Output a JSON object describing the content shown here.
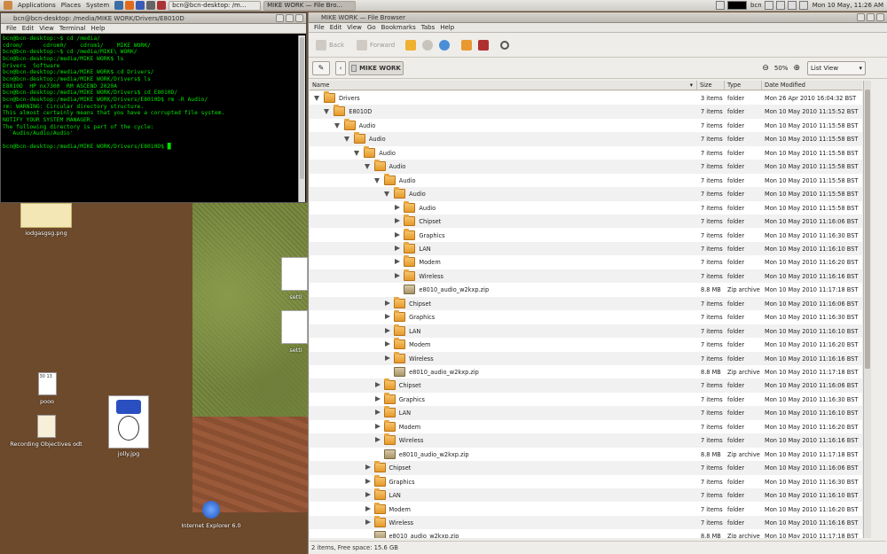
{
  "panel": {
    "applications": "Applications",
    "places": "Places",
    "system": "System",
    "task_terminal": "bcn@bcn-desktop: /m...",
    "task_filebrowser": "MIKE WORK — File Bro...",
    "user": "bcn",
    "clock": "Mon 10 May, 11:26 AM"
  },
  "desktop": {
    "icons": [
      {
        "label": "iodgasgsg.png"
      },
      {
        "label": "pooo"
      },
      {
        "label": "Recording Objectives odt"
      },
      {
        "label": "jolly.jpg"
      },
      {
        "label": "Internet Explorer 6.0"
      }
    ],
    "partial_labels": [
      "setti",
      "setti"
    ],
    "pooo_thumb_text": "30 13"
  },
  "terminal": {
    "title": "bcn@bcn-desktop: /media/MIKE WORK/Drivers/E8010D",
    "menu": [
      "File",
      "Edit",
      "View",
      "Terminal",
      "Help"
    ],
    "lines": [
      "bcn@bcn-desktop:~$ cd /media/",
      "cdrom/      cdrom0/    cdrom1/    MIKE WORK/",
      "bcn@bcn-desktop:~$ cd /media/MIKE\\ WORK/",
      "bcn@bcn-desktop:/media/MIKE WORK$ ls",
      "Drivers  Software",
      "bcn@bcn-desktop:/media/MIKE WORK$ cd Drivers/",
      "bcn@bcn-desktop:/media/MIKE WORK/Drivers$ ls",
      "E8010D  HP nx7300  RM ASCEND 2020A",
      "bcn@bcn-desktop:/media/MIKE WORK/Drivers$ cd E8010D/",
      "bcn@bcn-desktop:/media/MIKE WORK/Drivers/E8010D$ rm -R Audio/",
      "rm: WARNING: Circular directory structure.",
      "This almost certainly means that you have a corrupted file system.",
      "NOTIFY YOUR SYSTEM MANAGER.",
      "The following directory is part of the cycle:",
      "  `Audio/Audio/Audio'",
      "",
      "bcn@bcn-desktop:/media/MIKE WORK/Drivers/E8010D$ █"
    ]
  },
  "filebrowser": {
    "title": "MIKE WORK — File Browser",
    "menu": [
      "File",
      "Edit",
      "View",
      "Go",
      "Bookmarks",
      "Tabs",
      "Help"
    ],
    "toolbar": {
      "back": "Back",
      "forward": "Forward"
    },
    "location": "MIKE WORK",
    "zoom": "50%",
    "view_mode": "List View",
    "columns": [
      "Name",
      "Size",
      "Type",
      "Date Modified"
    ],
    "rows": [
      {
        "depth": 0,
        "exp": "open",
        "icon": "folder",
        "name": "Drivers",
        "size": "3 items",
        "type": "folder",
        "date": "Mon 26 Apr 2010 16:04:32 BST"
      },
      {
        "depth": 1,
        "exp": "open",
        "icon": "folder",
        "name": "E8010D",
        "size": "7 items",
        "type": "folder",
        "date": "Mon 10 May 2010 11:15:52 BST"
      },
      {
        "depth": 2,
        "exp": "open",
        "icon": "folder",
        "name": "Audio",
        "size": "7 items",
        "type": "folder",
        "date": "Mon 10 May 2010 11:15:58 BST"
      },
      {
        "depth": 3,
        "exp": "open",
        "icon": "folder",
        "name": "Audio",
        "size": "7 items",
        "type": "folder",
        "date": "Mon 10 May 2010 11:15:58 BST"
      },
      {
        "depth": 4,
        "exp": "open",
        "icon": "folder",
        "name": "Audio",
        "size": "7 items",
        "type": "folder",
        "date": "Mon 10 May 2010 11:15:58 BST"
      },
      {
        "depth": 5,
        "exp": "open",
        "icon": "folder",
        "name": "Audio",
        "size": "7 items",
        "type": "folder",
        "date": "Mon 10 May 2010 11:15:58 BST"
      },
      {
        "depth": 6,
        "exp": "open",
        "icon": "folder",
        "name": "Audio",
        "size": "7 items",
        "type": "folder",
        "date": "Mon 10 May 2010 11:15:58 BST"
      },
      {
        "depth": 7,
        "exp": "open",
        "icon": "folder",
        "name": "Audio",
        "size": "7 items",
        "type": "folder",
        "date": "Mon 10 May 2010 11:15:58 BST"
      },
      {
        "depth": 8,
        "exp": "closed",
        "icon": "folder",
        "name": "Audio",
        "size": "7 items",
        "type": "folder",
        "date": "Mon 10 May 2010 11:15:58 BST"
      },
      {
        "depth": 8,
        "exp": "closed",
        "icon": "folder",
        "name": "Chipset",
        "size": "7 items",
        "type": "folder",
        "date": "Mon 10 May 2010 11:16:06 BST"
      },
      {
        "depth": 8,
        "exp": "closed",
        "icon": "folder",
        "name": "Graphics",
        "size": "7 items",
        "type": "folder",
        "date": "Mon 10 May 2010 11:16:30 BST"
      },
      {
        "depth": 8,
        "exp": "closed",
        "icon": "folder",
        "name": "LAN",
        "size": "7 items",
        "type": "folder",
        "date": "Mon 10 May 2010 11:16:10 BST"
      },
      {
        "depth": 8,
        "exp": "closed",
        "icon": "folder",
        "name": "Modem",
        "size": "7 items",
        "type": "folder",
        "date": "Mon 10 May 2010 11:16:20 BST"
      },
      {
        "depth": 8,
        "exp": "closed",
        "icon": "folder",
        "name": "Wireless",
        "size": "7 items",
        "type": "folder",
        "date": "Mon 10 May 2010 11:16:16 BST"
      },
      {
        "depth": 8,
        "exp": "none",
        "icon": "zip",
        "name": "e8010_audio_w2kxp.zip",
        "size": "8.8 MB",
        "type": "Zip archive",
        "date": "Mon 10 May 2010 11:17:18 BST"
      },
      {
        "depth": 7,
        "exp": "closed",
        "icon": "folder",
        "name": "Chipset",
        "size": "7 items",
        "type": "folder",
        "date": "Mon 10 May 2010 11:16:06 BST"
      },
      {
        "depth": 7,
        "exp": "closed",
        "icon": "folder",
        "name": "Graphics",
        "size": "7 items",
        "type": "folder",
        "date": "Mon 10 May 2010 11:16:30 BST"
      },
      {
        "depth": 7,
        "exp": "closed",
        "icon": "folder",
        "name": "LAN",
        "size": "7 items",
        "type": "folder",
        "date": "Mon 10 May 2010 11:16:10 BST"
      },
      {
        "depth": 7,
        "exp": "closed",
        "icon": "folder",
        "name": "Modem",
        "size": "7 items",
        "type": "folder",
        "date": "Mon 10 May 2010 11:16:20 BST"
      },
      {
        "depth": 7,
        "exp": "closed",
        "icon": "folder",
        "name": "Wireless",
        "size": "7 items",
        "type": "folder",
        "date": "Mon 10 May 2010 11:16:16 BST"
      },
      {
        "depth": 7,
        "exp": "none",
        "icon": "zip",
        "name": "e8010_audio_w2kxp.zip",
        "size": "8.8 MB",
        "type": "Zip archive",
        "date": "Mon 10 May 2010 11:17:18 BST"
      },
      {
        "depth": 6,
        "exp": "closed",
        "icon": "folder",
        "name": "Chipset",
        "size": "7 items",
        "type": "folder",
        "date": "Mon 10 May 2010 11:16:06 BST"
      },
      {
        "depth": 6,
        "exp": "closed",
        "icon": "folder",
        "name": "Graphics",
        "size": "7 items",
        "type": "folder",
        "date": "Mon 10 May 2010 11:16:30 BST"
      },
      {
        "depth": 6,
        "exp": "closed",
        "icon": "folder",
        "name": "LAN",
        "size": "7 items",
        "type": "folder",
        "date": "Mon 10 May 2010 11:16:10 BST"
      },
      {
        "depth": 6,
        "exp": "closed",
        "icon": "folder",
        "name": "Modem",
        "size": "7 items",
        "type": "folder",
        "date": "Mon 10 May 2010 11:16:20 BST"
      },
      {
        "depth": 6,
        "exp": "closed",
        "icon": "folder",
        "name": "Wireless",
        "size": "7 items",
        "type": "folder",
        "date": "Mon 10 May 2010 11:16:16 BST"
      },
      {
        "depth": 6,
        "exp": "none",
        "icon": "zip",
        "name": "e8010_audio_w2kxp.zip",
        "size": "8.8 MB",
        "type": "Zip archive",
        "date": "Mon 10 May 2010 11:17:18 BST"
      },
      {
        "depth": 5,
        "exp": "closed",
        "icon": "folder",
        "name": "Chipset",
        "size": "7 items",
        "type": "folder",
        "date": "Mon 10 May 2010 11:16:06 BST"
      },
      {
        "depth": 5,
        "exp": "closed",
        "icon": "folder",
        "name": "Graphics",
        "size": "7 items",
        "type": "folder",
        "date": "Mon 10 May 2010 11:16:30 BST"
      },
      {
        "depth": 5,
        "exp": "closed",
        "icon": "folder",
        "name": "LAN",
        "size": "7 items",
        "type": "folder",
        "date": "Mon 10 May 2010 11:16:10 BST"
      },
      {
        "depth": 5,
        "exp": "closed",
        "icon": "folder",
        "name": "Modem",
        "size": "7 items",
        "type": "folder",
        "date": "Mon 10 May 2010 11:16:20 BST"
      },
      {
        "depth": 5,
        "exp": "closed",
        "icon": "folder",
        "name": "Wireless",
        "size": "7 items",
        "type": "folder",
        "date": "Mon 10 May 2010 11:16:16 BST"
      },
      {
        "depth": 5,
        "exp": "none",
        "icon": "zip",
        "name": "e8010_audio_w2kxp.zip",
        "size": "8.8 MB",
        "type": "Zip archive",
        "date": "Mon 10 May 2010 11:17:18 BST"
      }
    ],
    "status": "2 items, Free space: 15.6 GB"
  }
}
